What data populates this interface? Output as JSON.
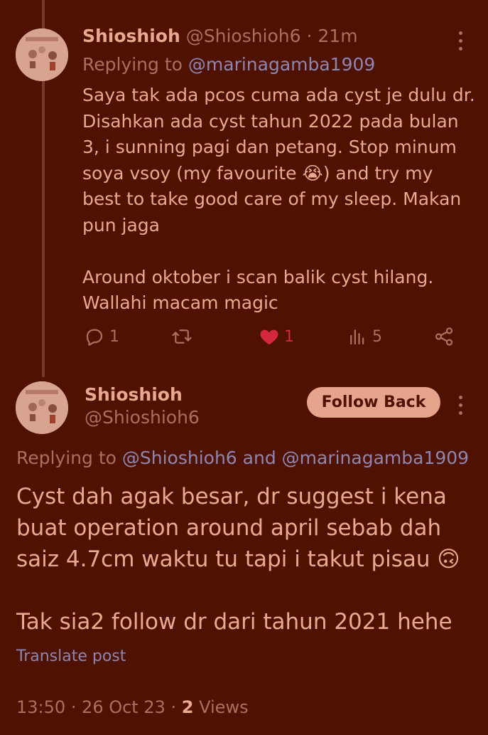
{
  "tweet1": {
    "display_name": "Shioshioh",
    "handle": "@Shioshioh6",
    "separator": " · ",
    "time": "21m",
    "replying_prefix": "Replying to ",
    "replying_to": "@marinagamba1909",
    "body": "Saya tak ada pcos cuma ada cyst je dulu dr. Disahkan ada cyst tahun 2022 pada bulan 3, i sunning pagi dan petang. Stop minum soya vsoy (my favourite 😭) and try my best to take good care of my sleep. Makan pun jaga\n\nAround oktober i scan balik cyst hilang. Wallahi macam magic",
    "actions": {
      "replies": "1",
      "retweets": "",
      "likes": "1",
      "views": "5"
    },
    "icons": [
      "reply-icon",
      "retweet-icon",
      "heart-filled-icon",
      "views-icon",
      "share-icon",
      "more-icon"
    ]
  },
  "tweet2": {
    "display_name": "Shioshioh",
    "handle": "@Shioshioh6",
    "follow_label": "Follow Back",
    "replying_prefix": "Replying to ",
    "replying_to_1": "@Shioshioh6",
    "replying_and": " and ",
    "replying_to_2": "@marinagamba1909",
    "body": "Cyst dah agak besar, dr suggest i kena buat operation around april sebab dah saiz 4.7cm waktu tu tapi i takut pisau 🙃\n\nTak sia2 follow dr dari tahun 2021 hehe",
    "translate_label": "Translate post",
    "timestamp": "13:50 · 26 Oct 23 · ",
    "views_count": "2",
    "views_label": " Views"
  },
  "colors": {
    "background": "#4f1200",
    "text": "#e9a98f",
    "muted": "#a8705f",
    "link": "#8e86b2",
    "like": "#d12840",
    "button_bg": "#e7a48c"
  }
}
